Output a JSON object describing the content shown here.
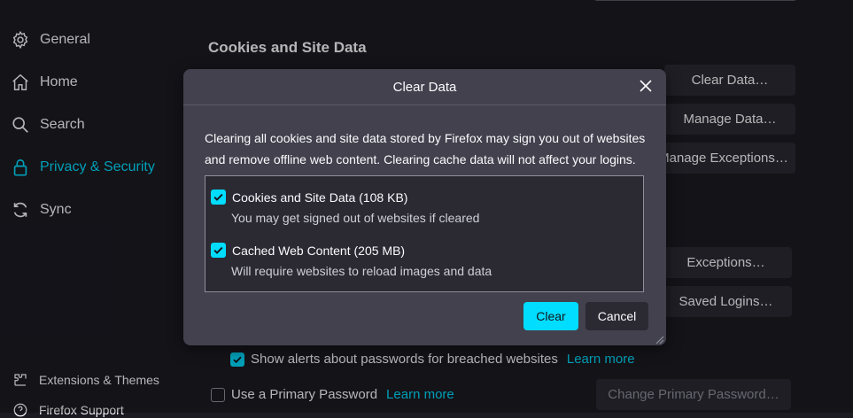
{
  "sidebar": {
    "items": [
      {
        "label": "General",
        "icon": "gear-icon"
      },
      {
        "label": "Home",
        "icon": "home-icon"
      },
      {
        "label": "Search",
        "icon": "search-icon"
      },
      {
        "label": "Privacy & Security",
        "icon": "lock-icon"
      },
      {
        "label": "Sync",
        "icon": "sync-icon"
      }
    ],
    "footer": [
      {
        "label": "Extensions & Themes",
        "icon": "puzzle-icon"
      },
      {
        "label": "Firefox Support",
        "icon": "help-icon"
      }
    ]
  },
  "content": {
    "section_title": "Cookies and Site Data",
    "buttons": {
      "clear_data": "Clear Data…",
      "manage_data": "Manage Data…",
      "manage_exceptions": "Manage Exceptions…",
      "exceptions": "Exceptions…",
      "saved_logins": "Saved Logins…",
      "change_primary_password": "Change Primary Password…"
    },
    "breach_alerts": {
      "label": "Show alerts about passwords for breached websites",
      "link": "Learn more",
      "checked": true
    },
    "primary_password": {
      "label": "Use a Primary Password",
      "link": "Learn more",
      "checked": false
    }
  },
  "dialog": {
    "title": "Clear Data",
    "description": "Clearing all cookies and site data stored by Firefox may sign you out of websites and remove offline web content. Clearing cache data will not affect your logins.",
    "options": [
      {
        "label": "Cookies and Site Data (108 KB)",
        "sub": "You may get signed out of websites if cleared",
        "checked": true
      },
      {
        "label": "Cached Web Content (205 MB)",
        "sub": "Will require websites to reload images and data",
        "checked": true
      }
    ],
    "clear_label": "Clear",
    "cancel_label": "Cancel"
  },
  "colors": {
    "accent": "#00ddff",
    "background": "#1c1b22",
    "dialog": "#42414d",
    "button": "#2b2a33"
  }
}
